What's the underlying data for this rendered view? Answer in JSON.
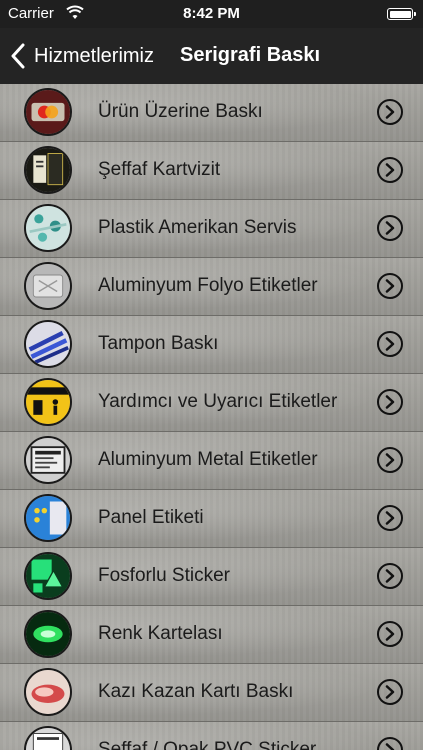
{
  "status_bar": {
    "carrier": "Carrier",
    "time": "8:42 PM"
  },
  "nav": {
    "back_label": "Hizmetlerimiz",
    "title": "Serigrafi Baskı"
  },
  "items": [
    {
      "label": "Ürün Üzerine Baskı",
      "icon": "mastercard-card-icon"
    },
    {
      "label": "Şeffaf Kartvizit",
      "icon": "transparent-card-icon"
    },
    {
      "label": "Plastik Amerikan Servis",
      "icon": "placemat-icon"
    },
    {
      "label": "Aluminyum Folyo Etiketler",
      "icon": "foil-label-icon"
    },
    {
      "label": "Tampon Baskı",
      "icon": "pens-icon"
    },
    {
      "label": "Yardımcı ve Uyarıcı Etiketler",
      "icon": "warning-label-icon"
    },
    {
      "label": "Aluminyum Metal Etiketler",
      "icon": "metal-label-icon"
    },
    {
      "label": "Panel Etiketi",
      "icon": "panel-label-icon"
    },
    {
      "label": "Fosforlu Sticker",
      "icon": "glow-sticker-icon"
    },
    {
      "label": "Renk Kartelası",
      "icon": "color-chart-icon"
    },
    {
      "label": "Kazı Kazan Kartı Baskı",
      "icon": "scratch-card-icon"
    },
    {
      "label": "Şeffaf / Opak PVC Sticker",
      "icon": "pvc-sticker-icon"
    }
  ]
}
